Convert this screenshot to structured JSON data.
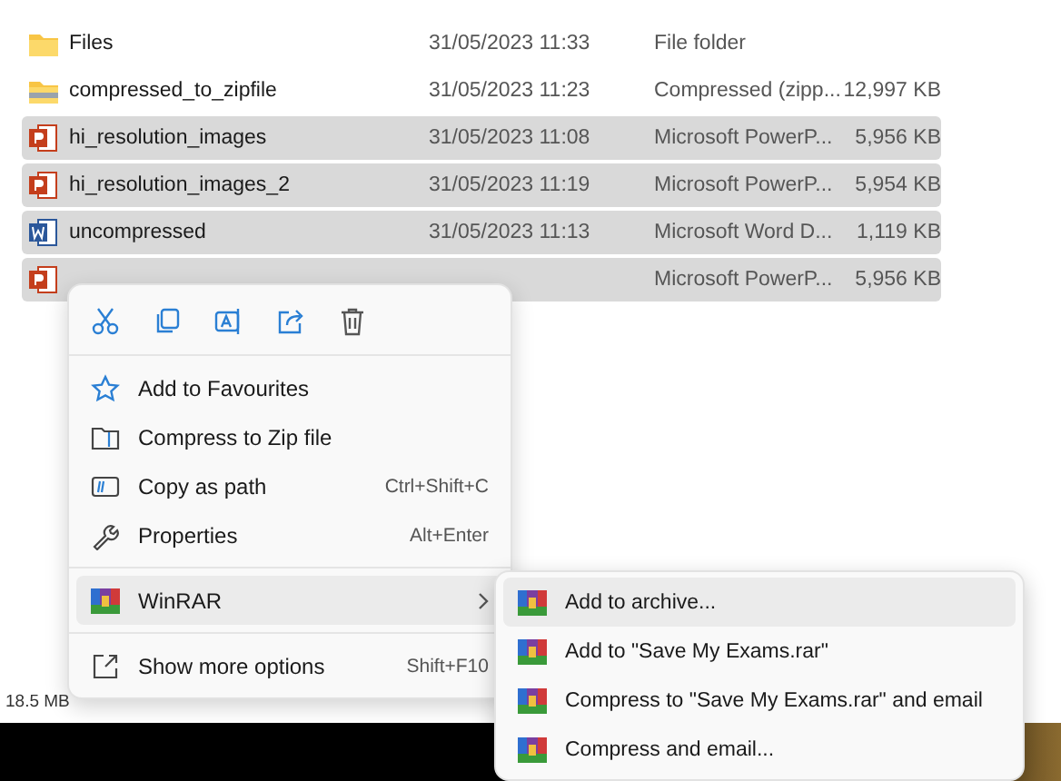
{
  "files": [
    {
      "kind": "folder",
      "name": "Files",
      "date": "31/05/2023 11:33",
      "type": "File folder",
      "selected": false
    },
    {
      "kind": "zip",
      "name": "compressed_to_zipfile",
      "date": "31/05/2023 11:23",
      "type": "Compressed (zipp...",
      "size": "12,997 KB",
      "selected": false
    },
    {
      "kind": "ppt",
      "name": "hi_resolution_images",
      "date": "31/05/2023 11:08",
      "type": "Microsoft PowerP...",
      "size": "5,956 KB",
      "selected": true
    },
    {
      "kind": "ppt",
      "name": "hi_resolution_images_2",
      "date": "31/05/2023 11:19",
      "type": "Microsoft PowerP...",
      "size": "5,954 KB",
      "selected": true
    },
    {
      "kind": "word",
      "name": "uncompressed",
      "date": "31/05/2023 11:13",
      "type": "Microsoft Word D...",
      "size": "1,119 KB",
      "selected": true
    },
    {
      "kind": "ppt",
      "type": "Microsoft PowerP...",
      "size": "5,956 KB",
      "selected": true
    }
  ],
  "context_menu": {
    "items": [
      {
        "kind": "star",
        "label": "Add to Favourites",
        "selected": false
      },
      {
        "kind": "zip",
        "label": "Compress to Zip file",
        "selected": false
      },
      {
        "kind": "path",
        "label": "Copy as path",
        "shortcut": "Ctrl+Shift+C",
        "selected": false
      },
      {
        "kind": "wrench",
        "label": "Properties",
        "shortcut": "Alt+Enter",
        "selected": false
      },
      {
        "kind": "winrar",
        "label": "WinRAR",
        "submenu": true,
        "selected": true
      },
      {
        "kind": "more",
        "label": "Show more options",
        "shortcut": "Shift+F10",
        "selected": false
      }
    ]
  },
  "submenu": {
    "items": [
      {
        "label": "Add to archive...",
        "selected": true
      },
      {
        "label": "Add to \"Save My Exams.rar\"",
        "selected": false
      },
      {
        "label": "Compress to \"Save My Exams.rar\" and email",
        "selected": false
      },
      {
        "label": "Compress and email...",
        "selected": false
      }
    ]
  },
  "status_bar": {
    "text": "18.5 MB"
  }
}
